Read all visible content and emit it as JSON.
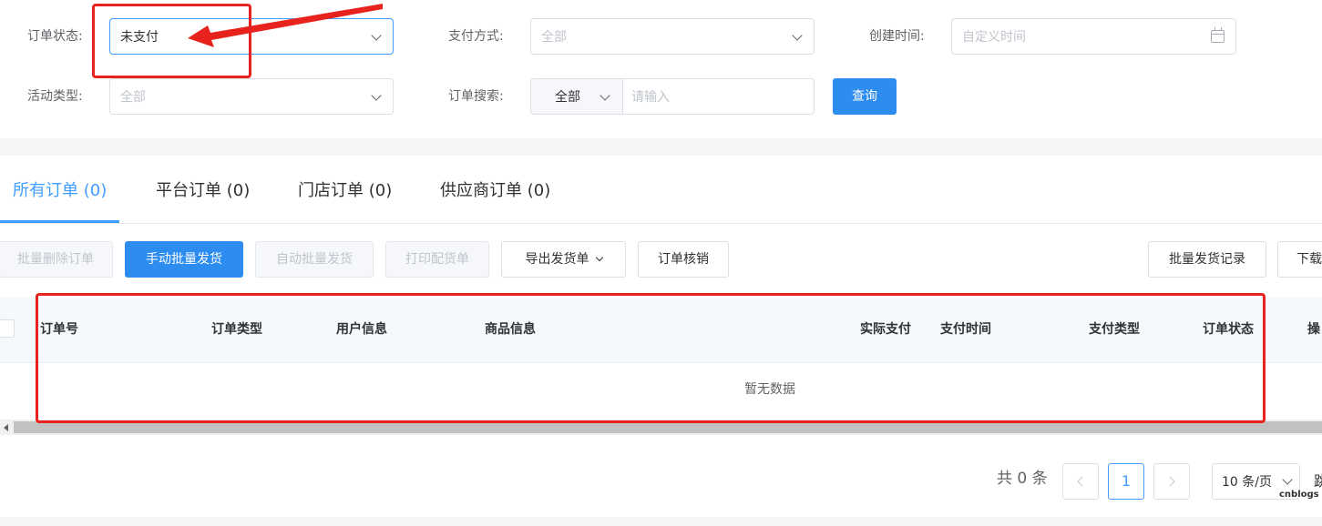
{
  "filters": {
    "order_status": {
      "label": "订单状态:",
      "value": "未支付"
    },
    "payment_method": {
      "label": "支付方式:",
      "placeholder": "全部"
    },
    "create_time": {
      "label": "创建时间:",
      "placeholder": "自定义时间"
    },
    "activity_type": {
      "label": "活动类型:",
      "placeholder": "全部"
    },
    "order_search": {
      "label": "订单搜索:",
      "scope": "全部",
      "placeholder": "请输入"
    },
    "query_label": "查询"
  },
  "tabs": [
    {
      "label": "所有订单 (0)",
      "active": true
    },
    {
      "label": "平台订单 (0)",
      "active": false
    },
    {
      "label": "门店订单 (0)",
      "active": false
    },
    {
      "label": "供应商订单 (0)",
      "active": false
    }
  ],
  "toolbar": {
    "batch_delete": "批量删除订单",
    "manual_batch_ship": "手动批量发货",
    "auto_batch_ship": "自动批量发货",
    "print_picking": "打印配货单",
    "export_shipping": "导出发货单",
    "order_verify": "订单核销",
    "batch_ship_records": "批量发货记录",
    "download": "下载"
  },
  "table": {
    "columns": [
      "订单号",
      "订单类型",
      "用户信息",
      "商品信息",
      "实际支付",
      "支付时间",
      "支付类型",
      "订单状态",
      "操"
    ],
    "empty_text": "暂无数据"
  },
  "pagination": {
    "total_text": "共 0 条",
    "current_page": "1",
    "page_size": "10 条/页",
    "goto_text": "跳"
  },
  "watermark": "cnblogs",
  "colors": {
    "primary": "#2d8cf0",
    "accent": "#409eff",
    "annotation": "#e8231e"
  }
}
